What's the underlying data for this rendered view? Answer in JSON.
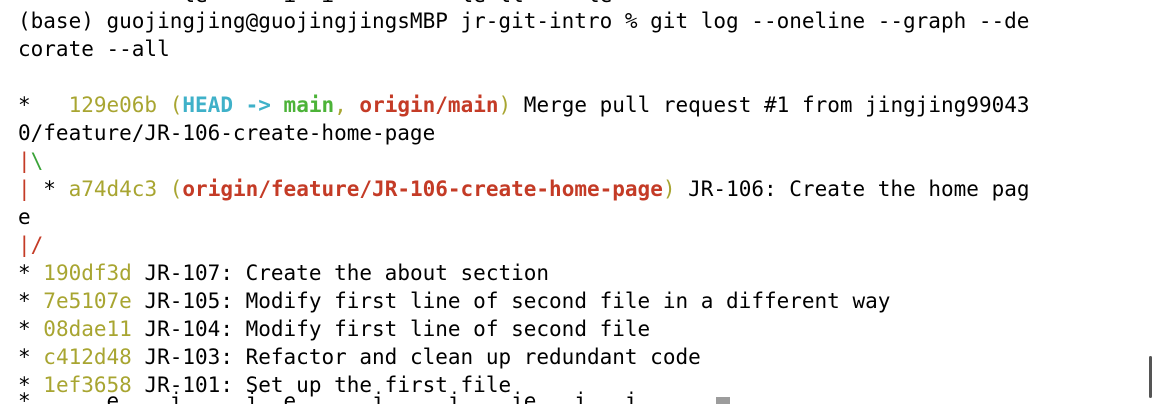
{
  "terminal": {
    "partial_top_line": "             le      i  i          le ll     le",
    "prompt": "(base) guojingjing@guojingjingsMBP jr-git-intro % ",
    "command_part1": "git log --oneline --graph --de",
    "command_part2": "corate --all",
    "commit1": {
      "graph": "*   ",
      "sha": "129e06b",
      "open": " (",
      "head": "HEAD -> ",
      "branch": "main",
      "sep": ", ",
      "remote": "origin/main",
      "close": ")",
      "msg_part1": " Merge pull request #1 from jingjing99043",
      "msg_part2": "0/feature/JR-106-create-home-page"
    },
    "graph_branch_pipe": "|",
    "graph_branch_slash": "\\",
    "commit2": {
      "graph_pipe": "|",
      "graph_star": " * ",
      "sha": "a74d4c3",
      "open": " (",
      "remote": "origin/feature/JR-106-create-home-page",
      "close": ")",
      "msg_part1": " JR-106: Create the home pag",
      "msg_part2": "e"
    },
    "graph_merge_pipe": "|",
    "graph_merge_slash": "/",
    "commits": [
      {
        "graph": "* ",
        "sha": "190df3d",
        "msg": " JR-107: Create the about section"
      },
      {
        "graph": "* ",
        "sha": "7e5107e",
        "msg": " JR-105: Modify first line of second file in a different way"
      },
      {
        "graph": "* ",
        "sha": "08dae11",
        "msg": " JR-104: Modify first line of second file"
      },
      {
        "graph": "* ",
        "sha": "c412d48",
        "msg": " JR-103: Refactor and clean up redundant code"
      },
      {
        "graph": "* ",
        "sha": "1ef3658",
        "msg": " JR-101: Set up the first file"
      }
    ],
    "partial_bottom_line": "*      e    i     i  e      i     i    ie   i   i"
  }
}
